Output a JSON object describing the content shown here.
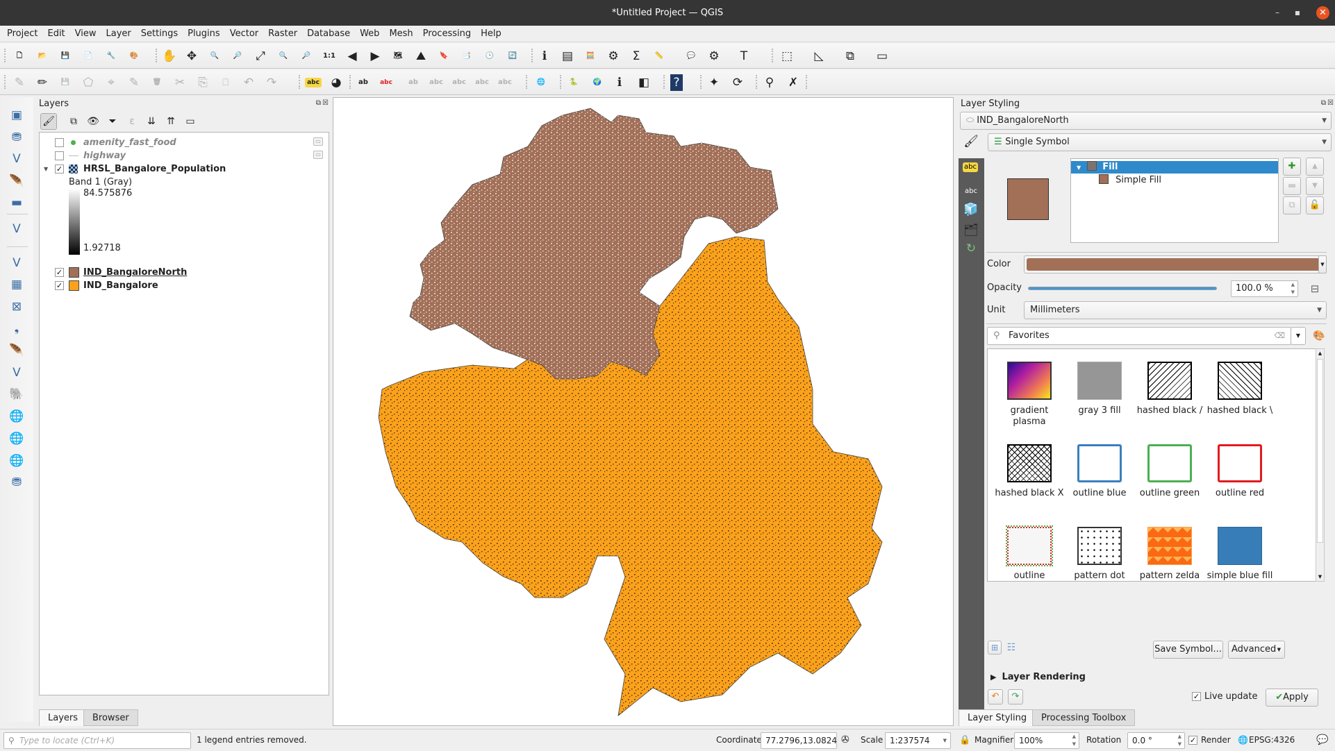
{
  "window": {
    "title": "*Untitled Project — QGIS",
    "controls": {
      "minimize": "–",
      "maximize": "▪",
      "close": "✕"
    }
  },
  "menubar": [
    "Project",
    "Edit",
    "View",
    "Layer",
    "Settings",
    "Plugins",
    "Vector",
    "Raster",
    "Database",
    "Web",
    "Mesh",
    "Processing",
    "Help"
  ],
  "toolbar1": [
    {
      "name": "new-project-icon",
      "glyph": "🗋"
    },
    {
      "name": "open-project-icon",
      "glyph": "📂"
    },
    {
      "name": "save-project-icon",
      "glyph": "💾"
    },
    {
      "name": "new-print-layout-icon",
      "glyph": "📄"
    },
    {
      "name": "layout-manager-icon",
      "glyph": "🔧"
    },
    {
      "name": "style-manager-icon",
      "glyph": "🎨"
    },
    {
      "name": "pan-map-icon",
      "glyph": "✋"
    },
    {
      "name": "pan-to-selection-icon",
      "glyph": "✥"
    },
    {
      "name": "zoom-in-icon",
      "glyph": "🔍"
    },
    {
      "name": "zoom-out-icon",
      "glyph": "🔎"
    },
    {
      "name": "zoom-full-icon",
      "glyph": "⤢"
    },
    {
      "name": "zoom-to-selection-icon",
      "glyph": "🔍"
    },
    {
      "name": "zoom-to-layer-icon",
      "glyph": "🔎"
    },
    {
      "name": "zoom-native-icon",
      "glyph": "1:1"
    },
    {
      "name": "zoom-last-icon",
      "glyph": "◀"
    },
    {
      "name": "zoom-next-icon",
      "glyph": "▶"
    },
    {
      "name": "new-map-view-icon",
      "glyph": "🗺"
    },
    {
      "name": "new-3d-map-view-icon",
      "glyph": "⛰"
    },
    {
      "name": "new-bookmark-icon",
      "glyph": "🔖"
    },
    {
      "name": "show-bookmarks-icon",
      "glyph": "📑"
    },
    {
      "name": "temporal-controller-icon",
      "glyph": "🕒"
    },
    {
      "name": "refresh-icon",
      "glyph": "🔄"
    },
    {
      "name": "identify-features-icon",
      "glyph": "ℹ"
    },
    {
      "name": "attribute-table-icon",
      "glyph": "▤"
    },
    {
      "name": "field-calculator-icon",
      "glyph": "🧮"
    },
    {
      "name": "processing-toolbox-icon",
      "glyph": "⚙"
    },
    {
      "name": "statistics-icon",
      "glyph": "Σ"
    },
    {
      "name": "measure-icon",
      "glyph": "📏"
    },
    {
      "name": "map-tips-icon",
      "glyph": "💬"
    },
    {
      "name": "actions-icon",
      "glyph": "⚙"
    },
    {
      "name": "text-annotation-icon",
      "glyph": "T"
    },
    {
      "name": "select-features-icon",
      "glyph": "⬚"
    },
    {
      "name": "deselect-features-icon",
      "glyph": "◺"
    },
    {
      "name": "deselect-all-icon",
      "glyph": "⧉"
    },
    {
      "name": "select-by-value-icon",
      "glyph": "▭"
    }
  ],
  "toolbar2": [
    {
      "name": "current-edits-icon",
      "glyph": "✎",
      "disabled": true
    },
    {
      "name": "toggle-editing-icon",
      "glyph": "✏",
      "disabled": false
    },
    {
      "name": "save-edits-icon",
      "glyph": "💾",
      "disabled": true
    },
    {
      "name": "add-polygon-icon",
      "glyph": "⬠",
      "disabled": true
    },
    {
      "name": "vertex-tool-icon",
      "glyph": "⌖",
      "disabled": true
    },
    {
      "name": "modify-attributes-icon",
      "glyph": "✎",
      "disabled": true
    },
    {
      "name": "delete-selected-icon",
      "glyph": "🗑",
      "disabled": true
    },
    {
      "name": "cut-features-icon",
      "glyph": "✂",
      "disabled": true
    },
    {
      "name": "copy-features-icon",
      "glyph": "⎘",
      "disabled": true
    },
    {
      "name": "paste-features-icon",
      "glyph": "📋",
      "disabled": true
    },
    {
      "name": "undo-icon",
      "glyph": "↶",
      "disabled": true
    },
    {
      "name": "redo-icon",
      "glyph": "↷",
      "disabled": true
    },
    {
      "name": "label-toolbar-icon",
      "glyph": "abc",
      "disabled": false
    },
    {
      "name": "diagram-icon",
      "glyph": "◕",
      "disabled": false
    },
    {
      "name": "pin-labels-icon",
      "glyph": "ab",
      "disabled": false
    },
    {
      "name": "show-hide-labels-icon",
      "glyph": "abc",
      "disabled": false
    },
    {
      "name": "move-label-icon",
      "glyph": "ab",
      "disabled": true
    },
    {
      "name": "rotate-label-icon",
      "glyph": "abc",
      "disabled": true
    },
    {
      "name": "change-label-icon",
      "glyph": "abc",
      "disabled": true
    },
    {
      "name": "label-props-icon",
      "glyph": "abc",
      "disabled": true
    },
    {
      "name": "label-misc-icon",
      "glyph": "abc",
      "disabled": true
    },
    {
      "name": "osm-download-icon",
      "glyph": "🌐",
      "disabled": false
    },
    {
      "name": "python-console-icon",
      "glyph": "🐍",
      "disabled": false
    },
    {
      "name": "globe-plugin-icon",
      "glyph": "🌍",
      "disabled": false
    },
    {
      "name": "metasearch-icon",
      "glyph": "ℹ",
      "disabled": false
    },
    {
      "name": "map-swipe-icon",
      "glyph": "◧",
      "disabled": false
    },
    {
      "name": "help-icon",
      "glyph": "?",
      "disabled": false
    },
    {
      "name": "georeferencer-icon",
      "glyph": "✦",
      "disabled": false
    },
    {
      "name": "table-sync-icon",
      "glyph": "⟳",
      "disabled": false
    },
    {
      "name": "locator-search-icon",
      "glyph": "⚲",
      "disabled": false
    },
    {
      "name": "qgis2web-icon",
      "glyph": "✗",
      "disabled": false
    }
  ],
  "left_toolbar": [
    {
      "name": "data-source-manager-icon",
      "glyph": "▣"
    },
    {
      "name": "new-geopackage-layer-icon",
      "glyph": "⛃"
    },
    {
      "name": "new-shapefile-layer-icon",
      "glyph": "V"
    },
    {
      "name": "new-spatialite-layer-icon",
      "glyph": "🪶"
    },
    {
      "name": "new-temporary-layer-icon",
      "glyph": "▬"
    },
    {
      "name": "new-virtual-layer-icon",
      "glyph": "V"
    },
    {
      "name": "add-vector-layer-icon",
      "glyph": "V"
    },
    {
      "name": "add-raster-layer-icon",
      "glyph": "▦"
    },
    {
      "name": "add-mesh-layer-icon",
      "glyph": "⊠"
    },
    {
      "name": "add-delimited-text-icon",
      "glyph": "❟"
    },
    {
      "name": "add-spatialite-layer-icon",
      "glyph": "🪶"
    },
    {
      "name": "add-virtual-layer-icon",
      "glyph": "V"
    },
    {
      "name": "add-postgis-layer-icon",
      "glyph": "🐘"
    },
    {
      "name": "add-wms-layer-icon",
      "glyph": "🌐"
    },
    {
      "name": "add-wcs-layer-icon",
      "glyph": "🌐"
    },
    {
      "name": "add-wfs-layer-icon",
      "glyph": "🌐"
    },
    {
      "name": "new-geopackage-icon",
      "glyph": "⛃"
    }
  ],
  "layers_panel": {
    "title": "Layers",
    "tools": [
      {
        "name": "style-panel-icon",
        "glyph": "🖌"
      },
      {
        "name": "add-group-icon",
        "glyph": "⧉"
      },
      {
        "name": "manage-themes-icon",
        "glyph": "👁"
      },
      {
        "name": "filter-legend-icon",
        "glyph": "⏷"
      },
      {
        "name": "filter-expression-icon",
        "glyph": "ε"
      },
      {
        "name": "expand-all-icon",
        "glyph": "⇊"
      },
      {
        "name": "collapse-all-icon",
        "glyph": "⇈"
      },
      {
        "name": "remove-layer-icon",
        "glyph": "▭"
      }
    ],
    "layers": [
      {
        "name": "amenity_fast_food",
        "checked": false,
        "style": "italic-gray",
        "symbol": "point",
        "color": "#4caf50"
      },
      {
        "name": "highway",
        "checked": false,
        "style": "italic-gray",
        "symbol": "line",
        "color": "#bbbbbb"
      },
      {
        "name": "HRSL_Bangalore_Population",
        "checked": true,
        "style": "bold",
        "symbol": "raster",
        "expanded": true
      },
      {
        "name": "IND_BangaloreNorth",
        "checked": true,
        "style": "bold-underline",
        "symbol": "fill",
        "color": "#a26f57"
      },
      {
        "name": "IND_Bangalore",
        "checked": true,
        "style": "bold",
        "symbol": "fill",
        "color": "#fba11b"
      }
    ],
    "raster_legend": {
      "band": "Band 1 (Gray)",
      "max": "84.575876",
      "min": "1.92718"
    },
    "tabs": [
      "Layers",
      "Browser"
    ],
    "active_tab": "Layers"
  },
  "map": {
    "layers_colors": {
      "north": "#a26f57",
      "bangalore": "#fba11b",
      "population": "#111111",
      "population_light": "#ffffff"
    }
  },
  "layer_styling": {
    "title": "Layer Styling",
    "layer": "IND_BangaloreNorth",
    "renderer": "Single Symbol",
    "symbol_tree": [
      {
        "label": "Fill",
        "selected": true
      },
      {
        "label": "Simple Fill",
        "selected": false
      }
    ],
    "symbol_color": "#a26f57",
    "color_label": "Color",
    "opacity_label": "Opacity",
    "opacity_value": "100.0 %",
    "opacity_fraction": 1.0,
    "unit_label": "Unit",
    "unit_value": "Millimeters",
    "search_value": "Favorites",
    "symbols": [
      {
        "label": "gradient plasma",
        "kind": "gradient"
      },
      {
        "label": "gray 3 fill",
        "kind": "gray"
      },
      {
        "label": "hashed black /",
        "kind": "hash-fwd"
      },
      {
        "label": "hashed black \\",
        "kind": "hash-back"
      },
      {
        "label": "hashed black X",
        "kind": "hash-x"
      },
      {
        "label": "outline blue",
        "kind": "outline",
        "color": "#3a7ebf"
      },
      {
        "label": "outline green",
        "kind": "outline",
        "color": "#4caf50"
      },
      {
        "label": "outline red",
        "kind": "outline",
        "color": "#e31a1c"
      },
      {
        "label": "outline xpattern",
        "kind": "xpattern"
      },
      {
        "label": "pattern dot black",
        "kind": "dots"
      },
      {
        "label": "pattern zelda",
        "kind": "zelda"
      },
      {
        "label": "simple blue fill",
        "kind": "solid",
        "color": "#377eb8"
      },
      {
        "label": "",
        "kind": "solid",
        "color": "#4daf4a"
      },
      {
        "label": "",
        "kind": "solid",
        "color": "#e41a1c"
      }
    ],
    "save_symbol_label": "Save Symbol...",
    "advanced_label": "Advanced",
    "layer_rendering_label": "Layer Rendering",
    "live_update_label": "Live update",
    "live_update_checked": true,
    "apply_label": "Apply",
    "tabs": [
      "Layer Styling",
      "Processing Toolbox"
    ],
    "active_tab": "Layer Styling"
  },
  "statusbar": {
    "locator_placeholder": "Type to locate (Ctrl+K)",
    "message": "1 legend entries removed.",
    "coordinate_label": "Coordinate",
    "coordinate_value": "77.2796,13.0824",
    "scale_label": "Scale",
    "scale_value": "1:237574",
    "magnifier_label": "Magnifier",
    "magnifier_value": "100%",
    "rotation_label": "Rotation",
    "rotation_value": "0.0 °",
    "render_label": "Render",
    "render_checked": true,
    "crs": "EPSG:4326"
  }
}
